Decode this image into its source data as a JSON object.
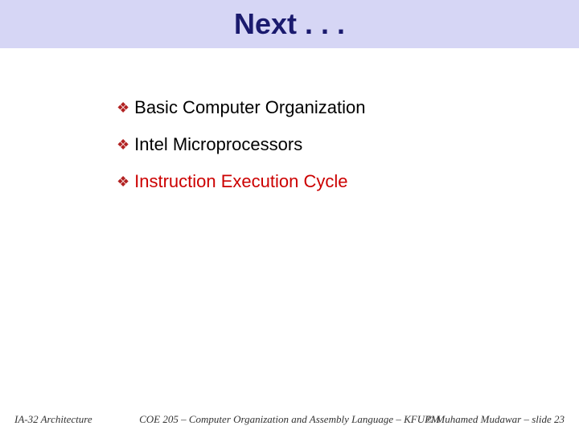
{
  "title": "Next . . .",
  "bullets": [
    {
      "text": "Basic Computer Organization",
      "highlight": false
    },
    {
      "text": "Intel Microprocessors",
      "highlight": false
    },
    {
      "text": "Instruction Execution Cycle",
      "highlight": true
    }
  ],
  "footer": {
    "left": "IA-32 Architecture",
    "center": "COE 205 – Computer Organization and Assembly Language – KFUPM",
    "right": "© Muhamed Mudawar – slide 23"
  }
}
